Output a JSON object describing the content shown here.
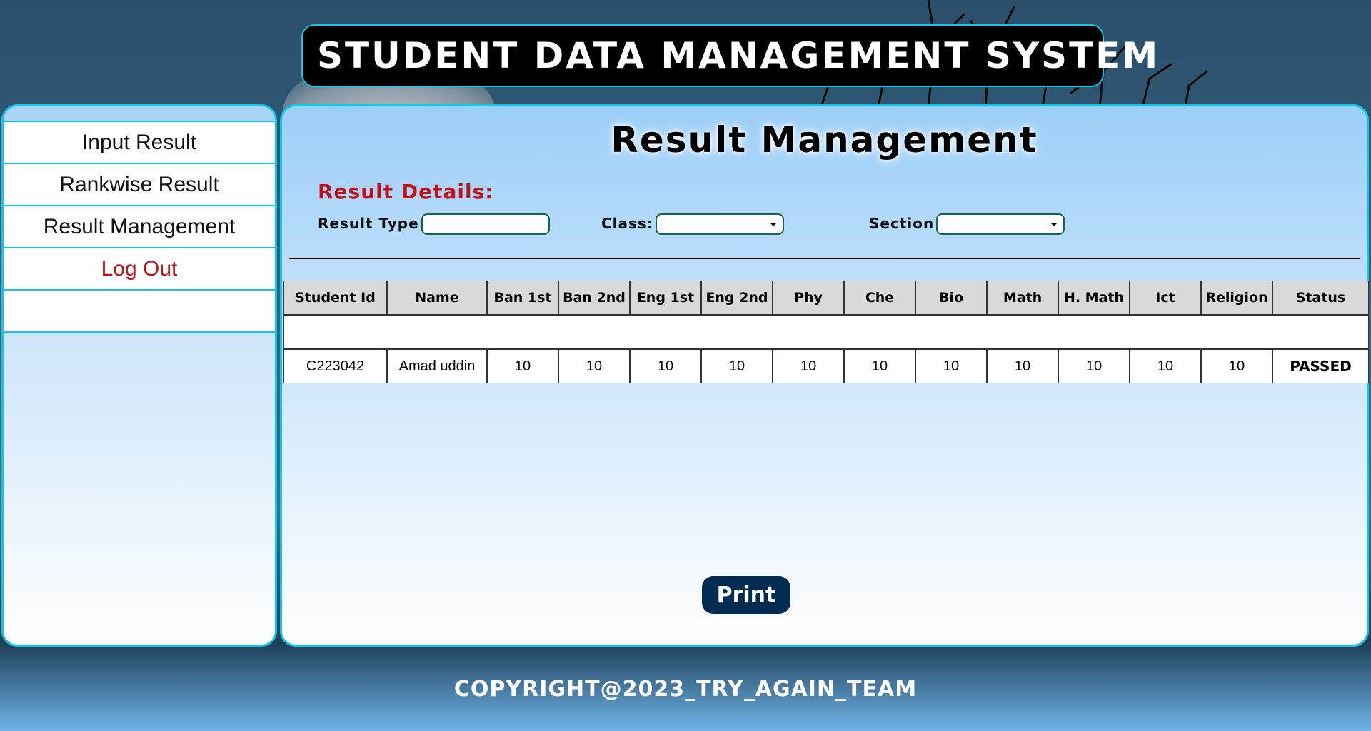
{
  "app": {
    "title": "STUDENT DATA MANAGEMENT SYSTEM"
  },
  "sidebar": {
    "items": [
      {
        "label": "Input Result"
      },
      {
        "label": "Rankwise Result"
      },
      {
        "label": "Result Management"
      },
      {
        "label": "Log Out"
      },
      {
        "label": ""
      }
    ]
  },
  "main": {
    "title": "Result Management",
    "details_label": "Result Details:",
    "filters": {
      "result_type_label": "Result Type:",
      "result_type_value": "",
      "class_label": "Class:",
      "class_value": "",
      "section_label": "Section",
      "section_value": ""
    },
    "table": {
      "headers": [
        "Student Id",
        "Name",
        "Ban 1st",
        "Ban 2nd",
        "Eng 1st",
        "Eng 2nd",
        "Phy",
        "Che",
        "Bio",
        "Math",
        "H. Math",
        "Ict",
        "Religion",
        "Status"
      ],
      "rows": [
        {
          "student_id": "C223042",
          "name": "Amad uddin",
          "ban_1st": "10",
          "ban_2nd": "10",
          "eng_1st": "10",
          "eng_2nd": "10",
          "phy": "10",
          "che": "10",
          "bio": "10",
          "math": "10",
          "h_math": "10",
          "ict": "10",
          "religion": "10",
          "status": "PASSED"
        }
      ]
    },
    "print_label": "Print"
  },
  "footer": {
    "copyright": "COPYRIGHT@2023_TRY_AGAIN_TEAM"
  },
  "colors": {
    "accent_border": "#13c6e6",
    "logout_text": "#c0121b",
    "status_passed": "#1e8a2c",
    "print_button": "#002c52"
  }
}
